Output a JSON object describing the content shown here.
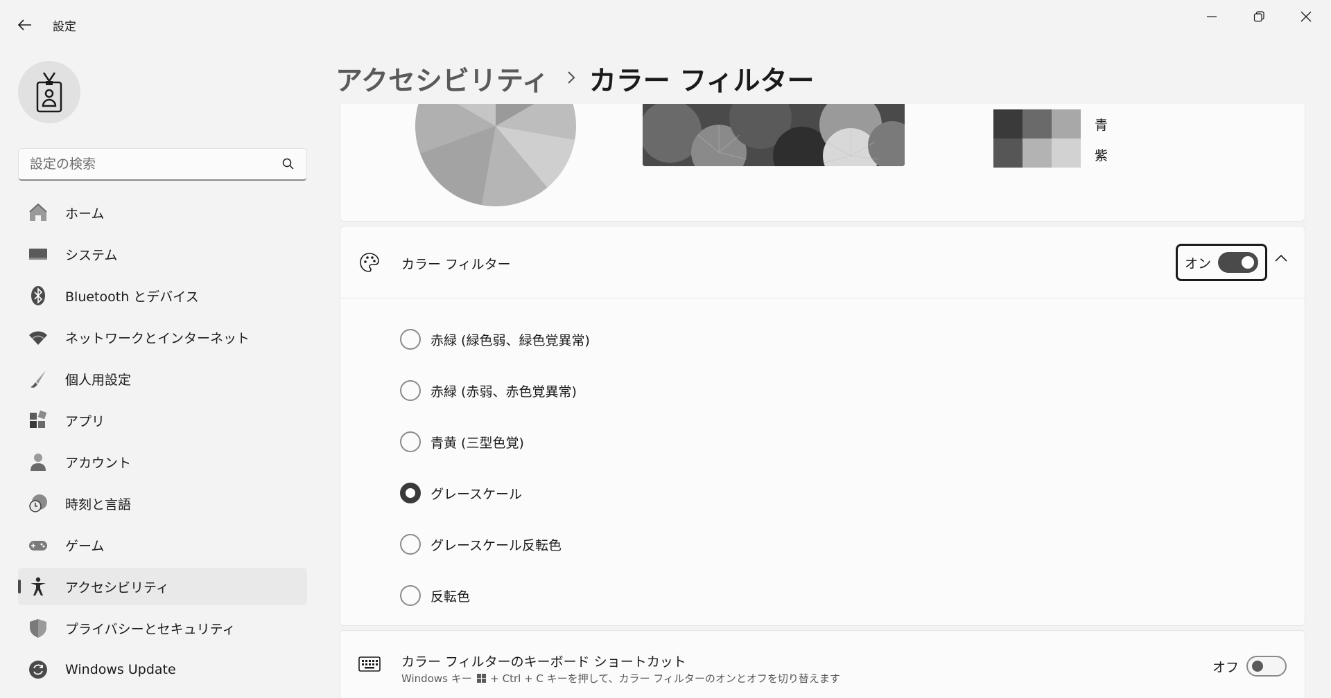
{
  "app": {
    "title": "設定"
  },
  "search": {
    "placeholder": "設定の検索"
  },
  "nav": {
    "items": [
      {
        "label": "ホーム",
        "icon": "home-icon"
      },
      {
        "label": "システム",
        "icon": "monitor-icon"
      },
      {
        "label": "Bluetooth とデバイス",
        "icon": "bluetooth-icon"
      },
      {
        "label": "ネットワークとインターネット",
        "icon": "wifi-icon"
      },
      {
        "label": "個人用設定",
        "icon": "brush-icon"
      },
      {
        "label": "アプリ",
        "icon": "apps-icon"
      },
      {
        "label": "アカウント",
        "icon": "person-icon"
      },
      {
        "label": "時刻と言語",
        "icon": "globe-clock-icon"
      },
      {
        "label": "ゲーム",
        "icon": "gamepad-icon"
      },
      {
        "label": "アクセシビリティ",
        "icon": "accessibility-icon",
        "active": true
      },
      {
        "label": "プライバシーとセキュリティ",
        "icon": "shield-icon"
      },
      {
        "label": "Windows Update",
        "icon": "update-icon"
      }
    ]
  },
  "header": {
    "parent": "アクセシビリティ",
    "current": "カラー フィルター"
  },
  "preview": {
    "swatch_labels": [
      "青",
      "紫"
    ]
  },
  "color_filter": {
    "title": "カラー フィルター",
    "toggle_label": "オン",
    "enabled": true,
    "options": [
      {
        "label": "赤緑 (緑色弱、緑色覚異常)",
        "checked": false
      },
      {
        "label": "赤緑 (赤弱、赤色覚異常)",
        "checked": false
      },
      {
        "label": "青黄 (三型色覚)",
        "checked": false
      },
      {
        "label": "グレースケール",
        "checked": true
      },
      {
        "label": "グレースケール反転色",
        "checked": false
      },
      {
        "label": "反転色",
        "checked": false
      }
    ]
  },
  "shortcut": {
    "title": "カラー フィルターのキーボード ショートカット",
    "desc_prefix": "Windows キー",
    "desc_suffix": " + Ctrl + C キーを押して、カラー フィルターのオンとオフを切り替えます",
    "toggle_label": "オフ",
    "enabled": false
  }
}
